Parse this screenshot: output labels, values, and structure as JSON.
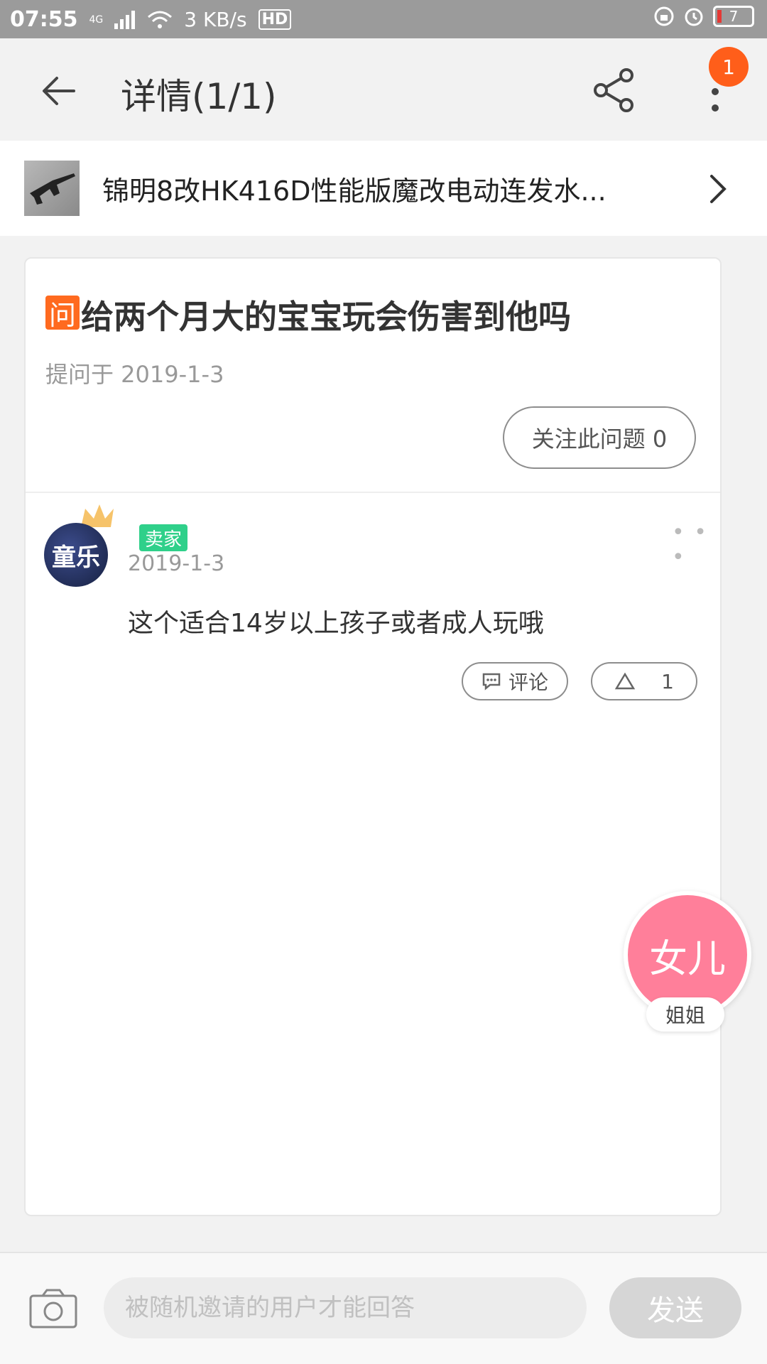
{
  "status_bar": {
    "time": "07:55",
    "network": "4G",
    "speed": "3 KB/s",
    "hd": "HD",
    "battery": "7",
    "battery_color": "#e53935"
  },
  "header": {
    "title": "详情(1/1)",
    "badge_count": "1",
    "icons": [
      "back-arrow-icon",
      "share-icon",
      "more-vertical-icon"
    ]
  },
  "product": {
    "name": "锦明8改HK416D性能版魔改电动连发水..."
  },
  "question": {
    "tag": "问",
    "text": "给两个月大的宝宝玩会伤害到他吗",
    "date": "提问于 2019-1-3",
    "follow_label": "关注此问题 0"
  },
  "answer": {
    "avatar_text": "童乐",
    "seller_tag": "卖家",
    "date": "2019-1-3",
    "text": "这个适合14岁以上孩子或者成人玩哦",
    "comment_label": "评论",
    "like_count": "1"
  },
  "floating": {
    "bubble_text": "女儿",
    "label": "姐姐",
    "bubble_color": "#ff7f9a"
  },
  "bottom": {
    "input_placeholder": "被随机邀请的用户才能回答",
    "send_label": "发送"
  }
}
